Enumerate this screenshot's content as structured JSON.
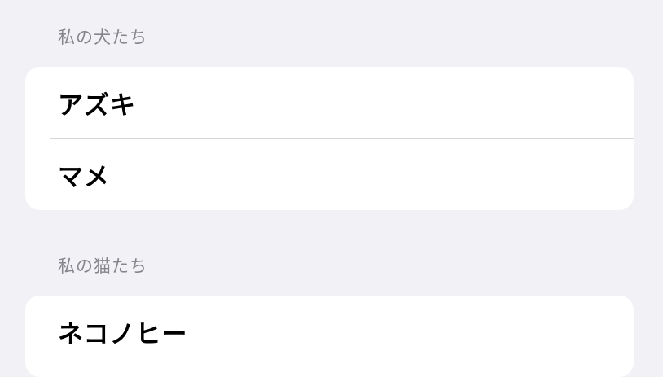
{
  "sections": [
    {
      "header": "私の犬たち",
      "items": [
        {
          "label": "アズキ"
        },
        {
          "label": "マメ"
        }
      ]
    },
    {
      "header": "私の猫たち",
      "items": [
        {
          "label": "ネコノヒー"
        }
      ]
    }
  ],
  "colors": {
    "background": "#f2f1f6",
    "card": "#ffffff",
    "header_text": "#86858b",
    "separator": "#d6d6da"
  }
}
